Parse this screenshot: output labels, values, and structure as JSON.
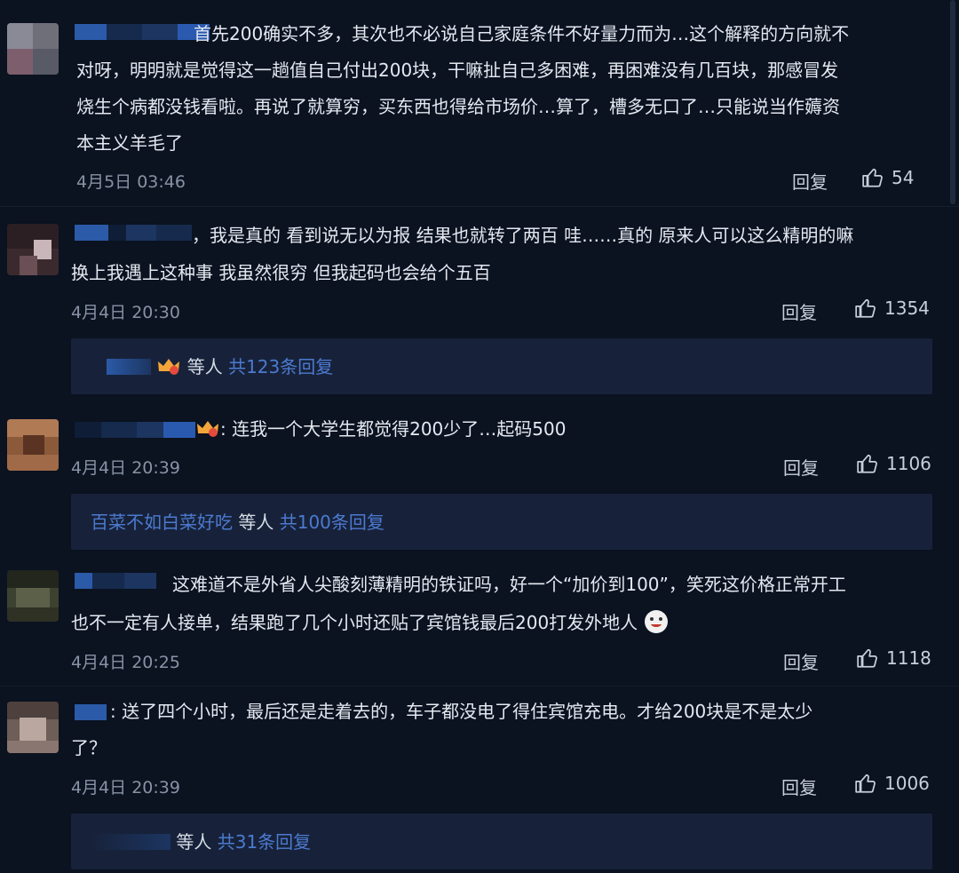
{
  "comments": [
    {
      "text_lines": [
        "首先200确实不多，其次也不必说自己家庭条件不好量力而为…这个解释的方向就不",
        "对呀，明明就是觉得这一趟值自己付出200块，干嘛扯自己多困难，再困难没有几百块，那感冒发",
        "烧生个病都没钱看啦。再说了就算穷，买东西也得给市场价…算了，槽多无口了…只能说当作薅资",
        "本主义羊毛了"
      ],
      "time": "4月5日 03:46",
      "reply_label": "回复",
      "likes": "54"
    },
    {
      "text_lines": [
        "，我是真的 看到说无以为报 结果也就转了两百 哇……真的 原来人可以这么精明的嘛",
        "换上我遇上这种事 我虽然很穷 但我起码也会给个五百"
      ],
      "time": "4月4日 20:30",
      "reply_label": "回复",
      "likes": "1354",
      "sub": {
        "others": "等人",
        "count": "共123条回复"
      }
    },
    {
      "text_lines": [
        ": 连我一个大学生都觉得200少了…起码500"
      ],
      "time": "4月4日 20:39",
      "reply_label": "回复",
      "likes": "1106",
      "sub": {
        "name": "百菜不如白菜好吃",
        "others": "等人",
        "count": "共100条回复"
      }
    },
    {
      "text_lines": [
        "这难道不是外省人尖酸刻薄精明的铁证吗，好一个“加价到100”，笑死这价格正常开工",
        "也不一定有人接单，结果跑了几个小时还贴了宾馆钱最后200打发外地人"
      ],
      "time": "4月4日 20:25",
      "reply_label": "回复",
      "likes": "1118"
    },
    {
      "text_lines": [
        ": 送了四个小时，最后还是走着去的，车子都没电了得住宾馆充电。才给200块是不是太少",
        "了？"
      ],
      "time": "4月4日 20:39",
      "reply_label": "回复",
      "likes": "1006",
      "sub": {
        "others": "等人",
        "count": "共31条回复"
      }
    }
  ]
}
